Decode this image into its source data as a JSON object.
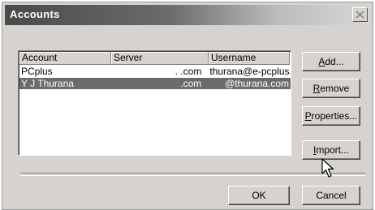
{
  "window": {
    "title": "Accounts"
  },
  "list": {
    "columns": [
      "Account",
      "Server",
      "Username"
    ],
    "rows": [
      {
        "account": "PCplus",
        "server": ". .com",
        "username": "thurana@e-pcplus.",
        "selected": false
      },
      {
        "account": "Y J Thurana",
        "server": ".com",
        "username": "@thurana.com",
        "selected": true
      }
    ]
  },
  "buttons": {
    "add": {
      "mnemonic": "A",
      "rest": "dd..."
    },
    "remove": {
      "mnemonic": "R",
      "rest": "emove"
    },
    "properties": {
      "mnemonic": "P",
      "rest": "roperties..."
    },
    "import": {
      "mnemonic": "I",
      "rest": "mport..."
    },
    "ok": "OK",
    "cancel": "Cancel"
  },
  "colors": {
    "selection": "#6b6b6b",
    "dialog_face": "#d6d3ce"
  },
  "icons": {
    "close": "close-icon",
    "cursor": "mouse-pointer-icon"
  }
}
